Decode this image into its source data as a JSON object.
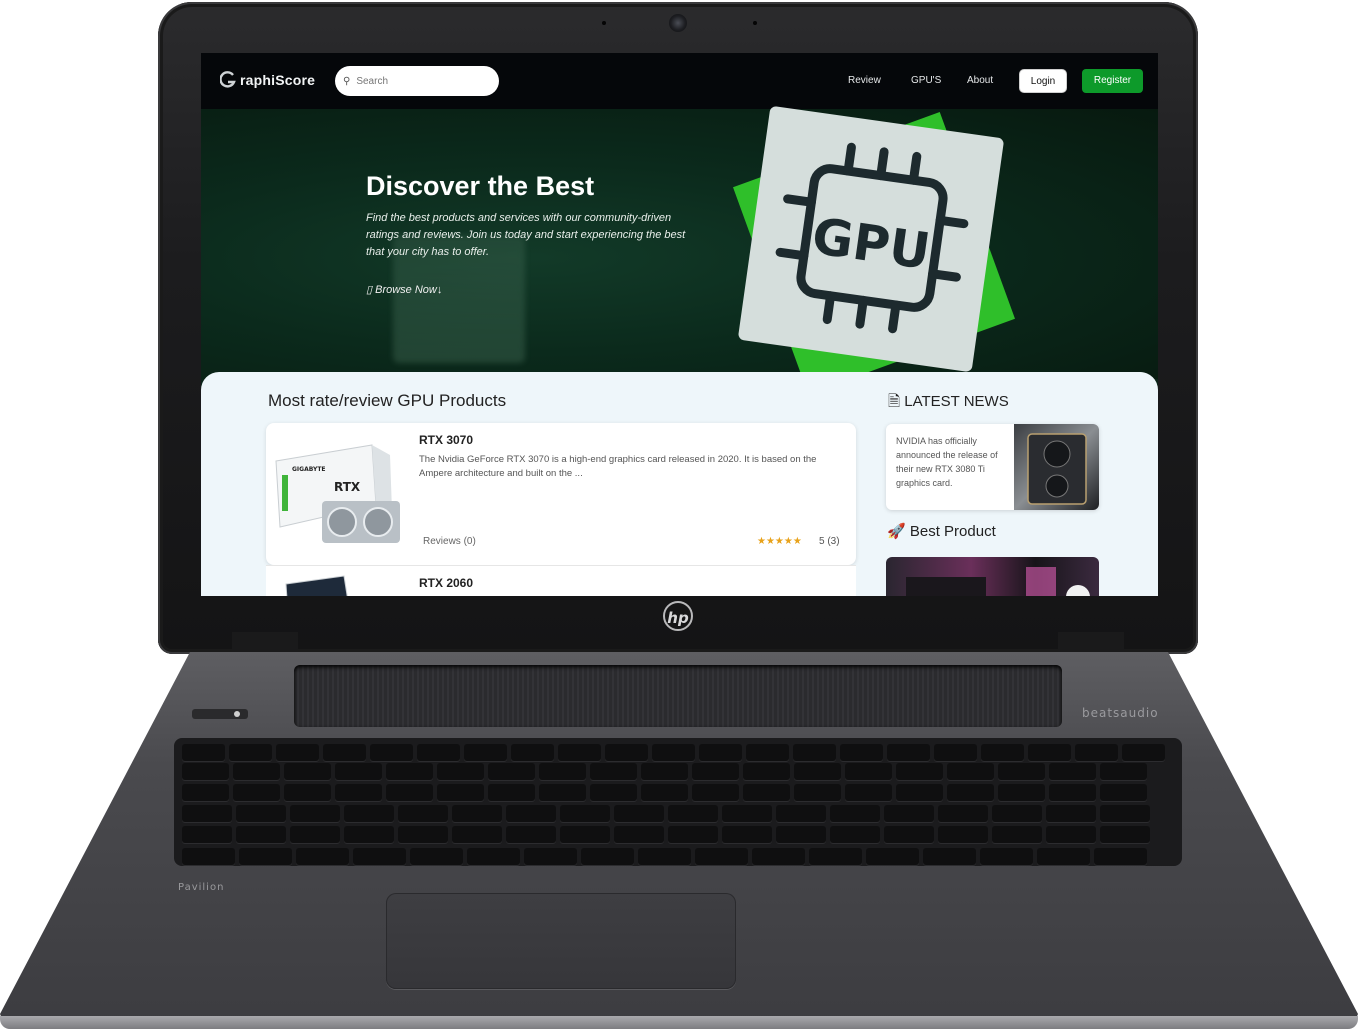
{
  "device": {
    "brand_logo": "hp",
    "speaker_brand": "beatsaudio",
    "model_label": "Pavilion"
  },
  "navbar": {
    "brand": "raphiScore",
    "brand_icon": "g-logo-icon",
    "search_placeholder": "Search",
    "links": [
      "Review",
      "GPU'S",
      "About"
    ],
    "login": "Login",
    "register": "Register",
    "register_color": "#0d9a2a"
  },
  "hero": {
    "title": "Discover the Best",
    "text": "Find the best products and services with our community-driven ratings and reviews. Join us today and start experiencing the best that your city has to offer.",
    "cta": "Browse Now",
    "cta_icon": "mouse-icon",
    "badge_text": "GPU",
    "accent": "#2fbf2a"
  },
  "products_section": {
    "title": "Most rate/review GPU Products",
    "items": [
      {
        "name": "RTX 3070",
        "description": "The Nvidia GeForce RTX 3070 is a high-end graphics card released in 2020. It is based on the Ampere architecture and built on the ...",
        "reviews_label": "Reviews (0)",
        "stars": "★★★★★",
        "rating": "5 (3)",
        "box_brand": "GIGABYTE",
        "box_label": "RTX"
      },
      {
        "name": "RTX 2060"
      }
    ]
  },
  "news": {
    "title": "LATEST NEWS",
    "icon": "document-icon",
    "items": [
      {
        "text": "NVIDIA has officially announced the release of their new RTX 3080 Ti graphics card."
      }
    ]
  },
  "best_product": {
    "title": "Best Product",
    "icon": "rocket-icon"
  }
}
